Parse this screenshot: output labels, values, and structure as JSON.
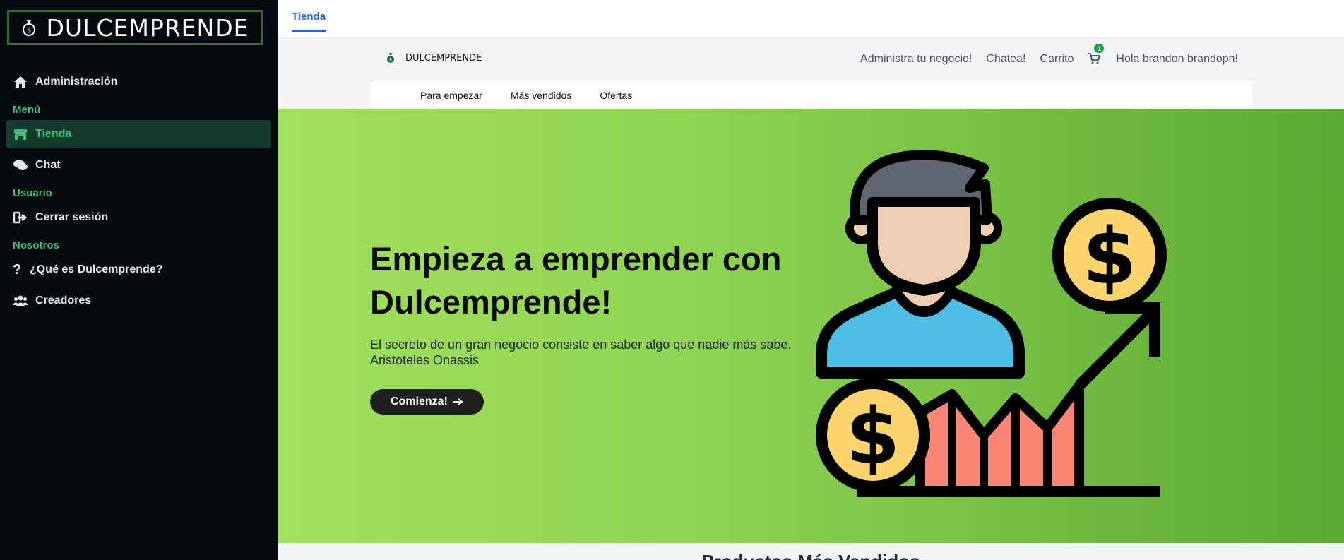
{
  "app": {
    "brand": "DULCEMPRENDE"
  },
  "sidebar": {
    "admin": "Administración",
    "sections": {
      "menu": "Menú",
      "user": "Usuario",
      "us": "Nosotros"
    },
    "items": {
      "tienda": "Tienda",
      "chat": "Chat",
      "logout": "Cerrar sesión",
      "about": "¿Qué es Dulcemprende?",
      "creators": "Creadores"
    }
  },
  "tabbar": {
    "active_tab": "Tienda"
  },
  "store_header": {
    "logo_text": "DULCEMPRENDE",
    "links": {
      "admin": "Administra tu negocio!",
      "chat": "Chatea!",
      "cart": "Carrito",
      "cart_count": "1",
      "greeting": "Hola brandon brandopn!"
    }
  },
  "subnav": [
    "Para empezar",
    "Más vendidos",
    "Ofertas"
  ],
  "hero": {
    "title": "Empieza a emprender con Dulcemprende!",
    "quote_line1": "El secreto de un gran negocio consiste en saber algo que nadie más sabe.",
    "quote_line2": "Aristoteles Onassis",
    "button": "Comienza!",
    "button_icon": "arrow-right-icon"
  },
  "next_section": {
    "heading": "Productos Más Vendidos"
  },
  "colors": {
    "accent": "#34c07a",
    "sidebar_bg": "#060b10",
    "link_blue": "#2563eb"
  }
}
